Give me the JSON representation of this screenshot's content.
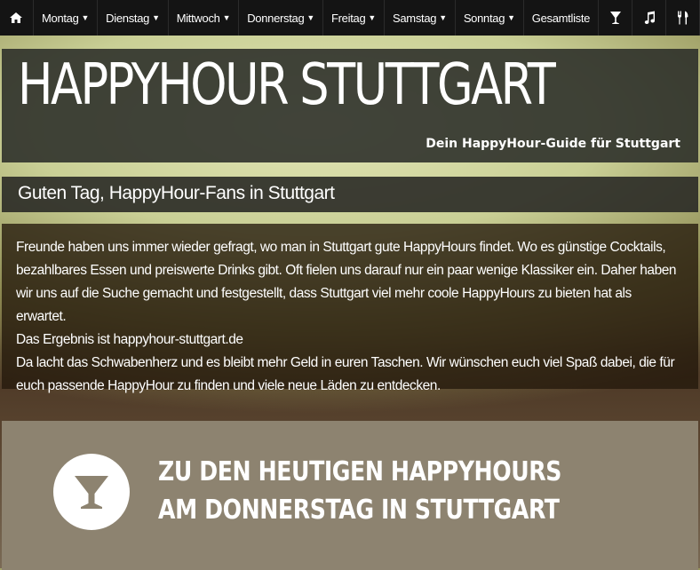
{
  "nav": {
    "home_icon": "home-icon",
    "items": [
      {
        "label": "Montag",
        "dropdown": true
      },
      {
        "label": "Dienstag",
        "dropdown": true
      },
      {
        "label": "Mittwoch",
        "dropdown": true
      },
      {
        "label": "Donnerstag",
        "dropdown": true
      },
      {
        "label": "Freitag",
        "dropdown": true
      },
      {
        "label": "Samstag",
        "dropdown": true
      },
      {
        "label": "Sonntag",
        "dropdown": true
      },
      {
        "label": "Gesamtliste",
        "dropdown": false
      }
    ],
    "icons": [
      "cocktail-icon",
      "music-icon",
      "restaurant-icon"
    ]
  },
  "header": {
    "title": "HAPPYHOUR STUTTGART",
    "subtitle": "Dein HappyHour-Guide für Stuttgart"
  },
  "welcome": {
    "title": "Guten Tag, HappyHour-Fans in Stuttgart"
  },
  "intro": {
    "paragraph1": "Freunde haben uns immer wieder gefragt, wo man in Stuttgart gute HappyHours findet. Wo es günstige Cocktails, bezahlbares Essen und preiswerte Drinks gibt. Oft fielen uns darauf nur ein paar wenige Klassiker ein. Daher haben wir uns auf die Suche gemacht und festgestellt, dass Stuttgart viel mehr coole HappyHours zu bieten hat als erwartet.",
    "paragraph2": "Das Ergebnis ist happyhour-stuttgart.de",
    "paragraph3": "Da lacht das Schwabenherz und es bleibt mehr Geld in euren Taschen. Wir wünschen euch viel Spaß dabei, die für euch passende HappyHour zu finden und viele neue Läden zu entdecken."
  },
  "cta": {
    "icon": "cocktail-glass-icon",
    "text": "ZU DEN HEUTIGEN HAPPYHOURS AM DONNERSTAG IN STUTTGART"
  },
  "colors": {
    "nav_bg": "#141414",
    "panel_bg": "#2a2c28",
    "cta_bg": "#8d8370",
    "text": "#ffffff"
  }
}
